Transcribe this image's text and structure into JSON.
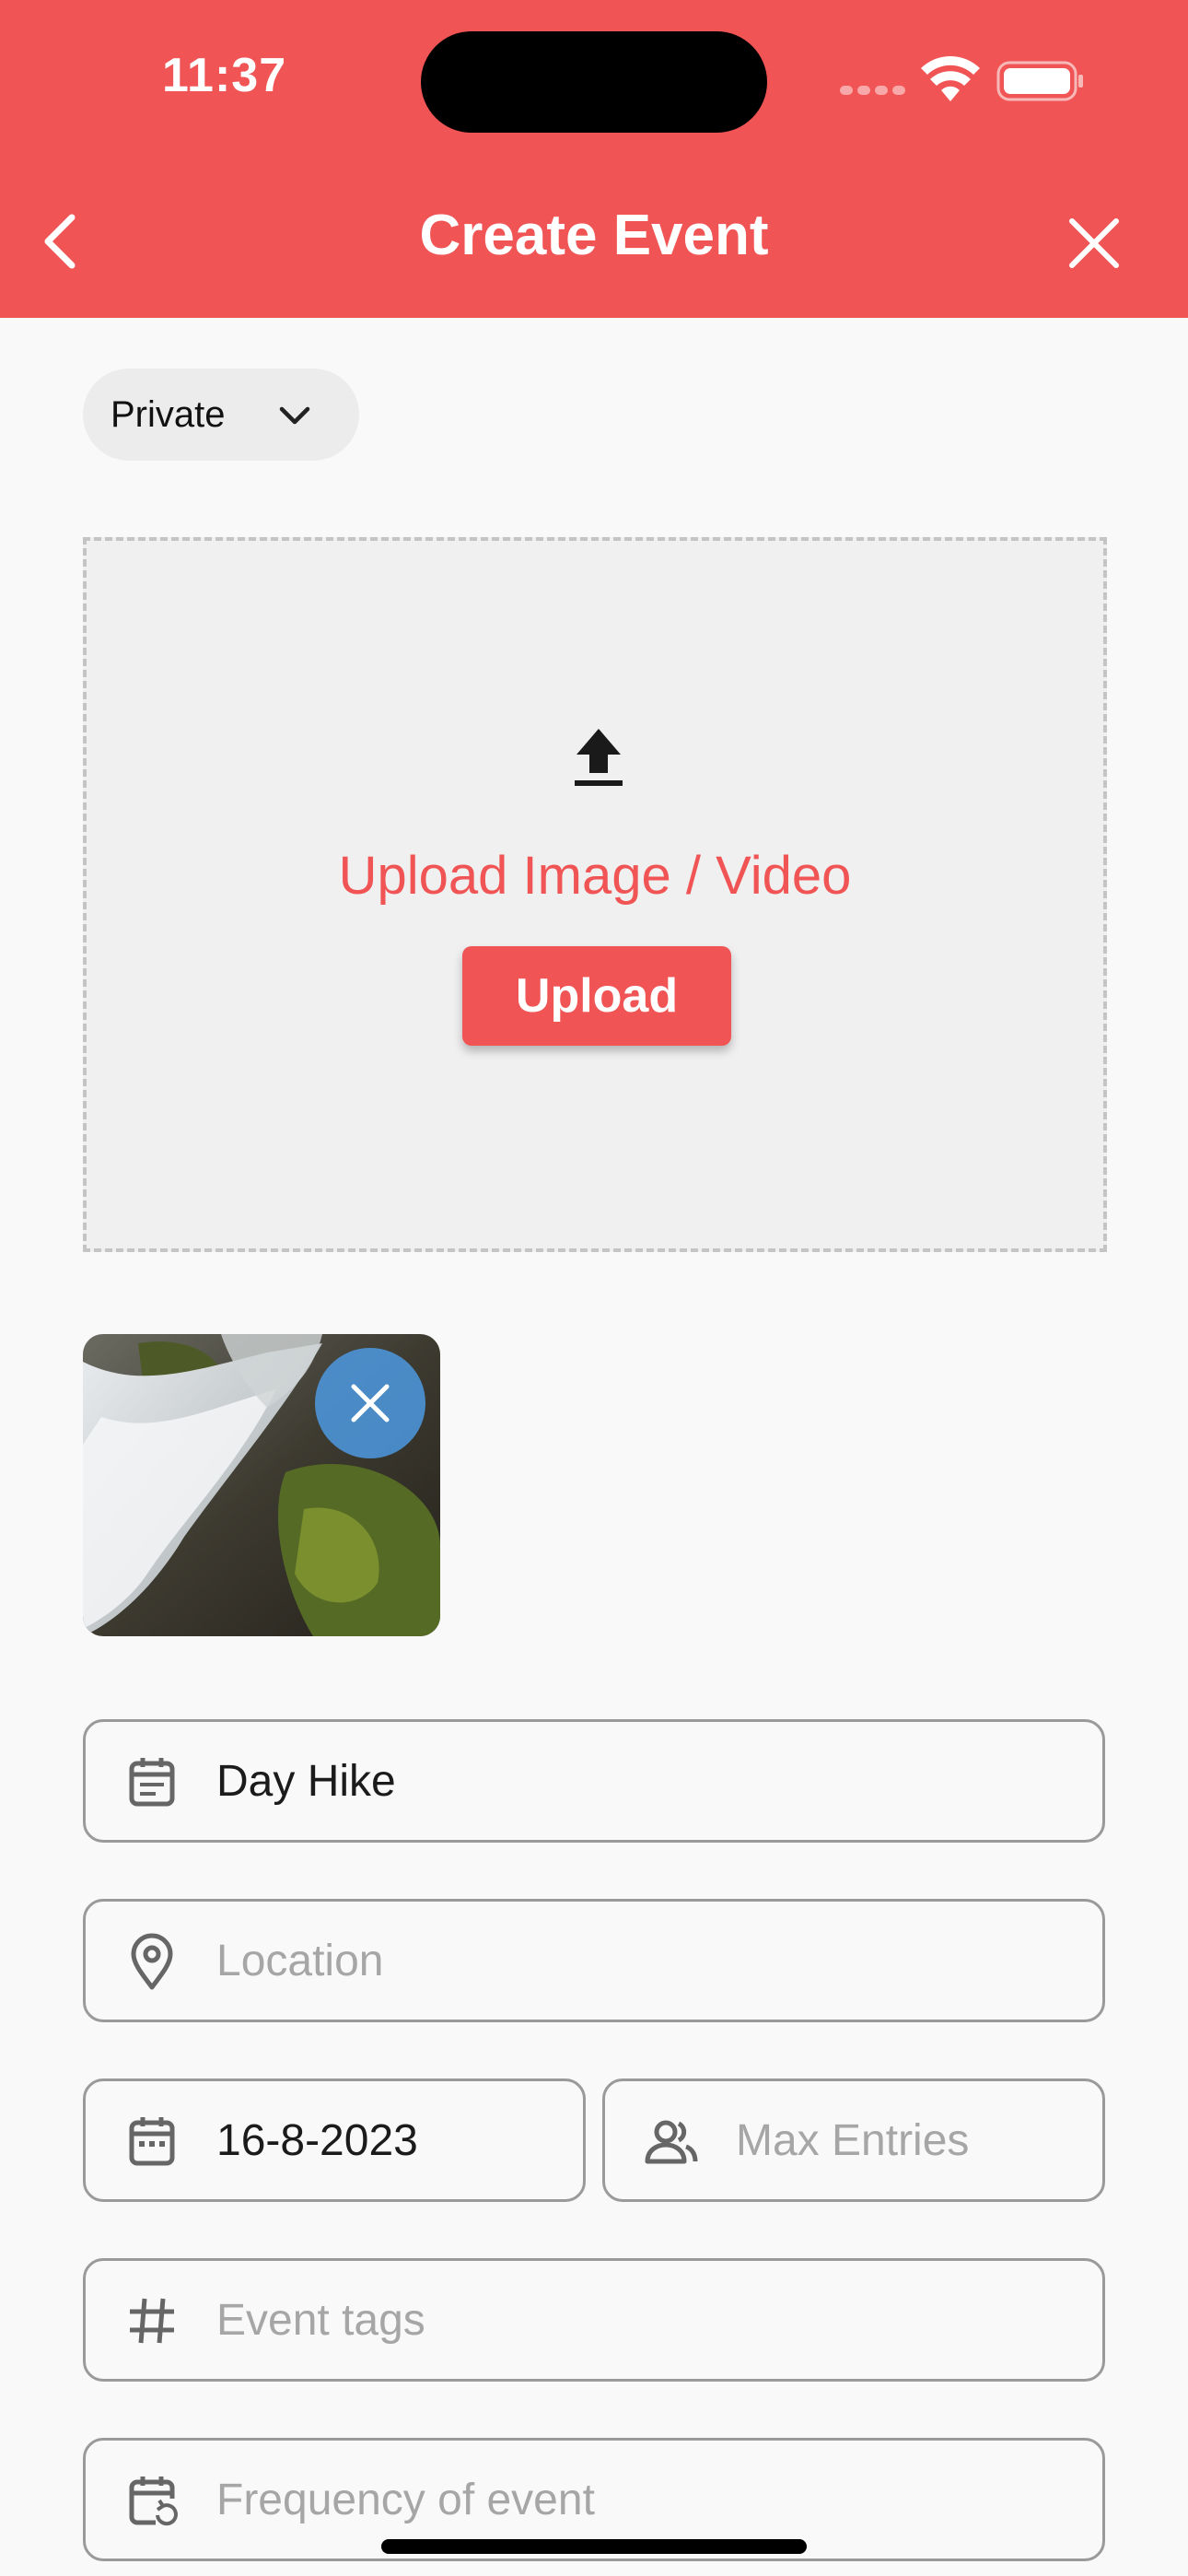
{
  "status_bar": {
    "time": "11:37"
  },
  "nav": {
    "title": "Create Event"
  },
  "privacy": {
    "selected": "Private"
  },
  "upload": {
    "prompt": "Upload Image / Video",
    "button_label": "Upload"
  },
  "fields": {
    "name": {
      "value": "Day Hike"
    },
    "location": {
      "placeholder": "Location"
    },
    "date": {
      "value": "16-8-2023"
    },
    "max_entries": {
      "placeholder": "Max Entries"
    },
    "tags": {
      "placeholder": "Event tags"
    },
    "frequency": {
      "placeholder": "Frequency of event"
    }
  },
  "colors": {
    "accent": "#f05454",
    "overlay_blue": "#4c96dc",
    "border": "#9a9a9a"
  },
  "icons": {
    "back": "chevron-left-icon",
    "close": "close-icon",
    "upload": "upload-icon",
    "name": "event-note-icon",
    "location": "location-pin-icon",
    "date": "calendar-icon",
    "max_entries": "people-icon",
    "tags": "hashtag-icon",
    "frequency": "calendar-repeat-icon"
  }
}
